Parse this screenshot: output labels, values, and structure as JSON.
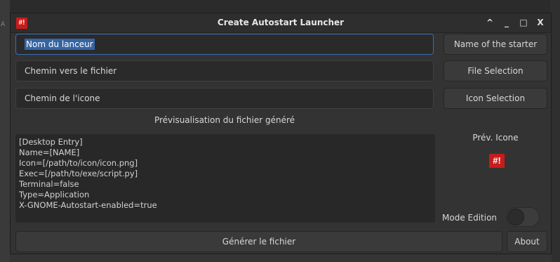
{
  "window": {
    "logo_text": "#!",
    "title": "Create Autostart Launcher",
    "controls": {
      "collapse": "^",
      "minimize": "_",
      "maximize": "□",
      "close": "X"
    }
  },
  "fields": {
    "name": {
      "value": "Nom du lanceur"
    },
    "file_path": {
      "value": "Chemin vers le fichier"
    },
    "icon_path": {
      "value": "Chemin de l'icone"
    }
  },
  "buttons": {
    "name": "Name of the starter",
    "file": "File Selection",
    "icon": "Icon Selection",
    "generate": "Générer le fichier",
    "about": "About"
  },
  "preview": {
    "label": "Prévisualisation du fichier généré",
    "lines": [
      "[Desktop Entry]",
      "Name=[NAME]",
      "Icon=[/path/to/icon/icon.png]",
      "Exec=[/path/to/exe/script.py]",
      "Terminal=false",
      "Type=Application",
      "X-GNOME-Autostart-enabled=true"
    ]
  },
  "icon_preview": {
    "label": "Prév. Icone",
    "glyph": "#!"
  },
  "mode": {
    "label": "Mode Edition",
    "enabled": false
  },
  "colors": {
    "accent": "#3465a4",
    "logo_red": "#c81b1b"
  }
}
